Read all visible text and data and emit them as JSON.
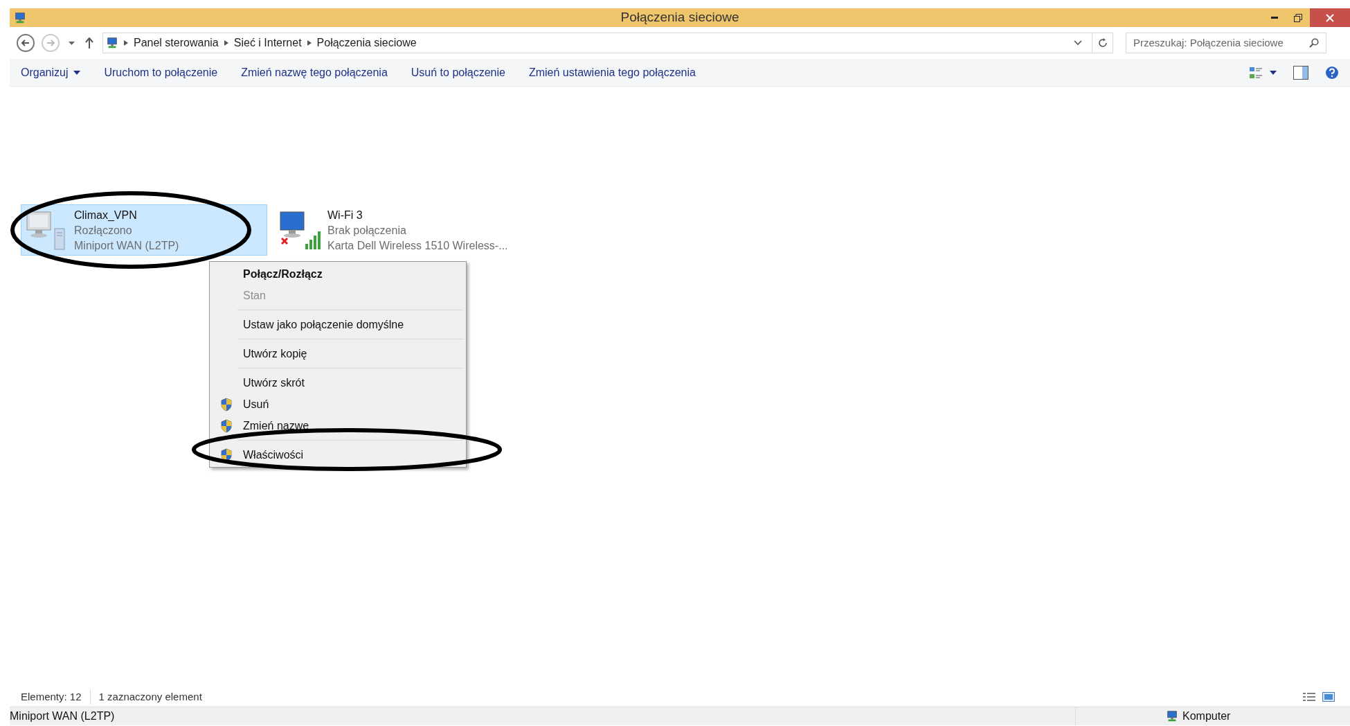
{
  "window": {
    "title": "Połączenia sieciowe"
  },
  "breadcrumb": [
    "Panel sterowania",
    "Sieć i Internet",
    "Połączenia sieciowe"
  ],
  "search": {
    "placeholder": "Przeszukaj: Połączenia sieciowe"
  },
  "toolbar": [
    {
      "label": "Organizuj",
      "dropdown": true
    },
    {
      "label": "Uruchom to połączenie",
      "dropdown": false
    },
    {
      "label": "Zmień nazwę tego połączenia",
      "dropdown": false
    },
    {
      "label": "Usuń to połączenie",
      "dropdown": false
    },
    {
      "label": "Zmień ustawienia tego połączenia",
      "dropdown": false
    }
  ],
  "connections": [
    {
      "kind": "vpn",
      "name": "Climax_VPN",
      "status": "Rozłączono",
      "device": "Miniport WAN (L2TP)",
      "selected": true
    },
    {
      "kind": "wifi",
      "name": "Wi-Fi 3",
      "status": "Brak połączenia",
      "device": "Karta Dell Wireless 1510 Wireless-...",
      "selected": false
    }
  ],
  "context_menu": [
    {
      "label": "Połącz/Rozłącz",
      "default": true,
      "disabled": false,
      "shield": false,
      "separator_before": false
    },
    {
      "label": "Stan",
      "default": false,
      "disabled": true,
      "shield": false,
      "separator_before": false
    },
    {
      "label": "Ustaw jako połączenie domyślne",
      "default": false,
      "disabled": false,
      "shield": false,
      "separator_before": true
    },
    {
      "label": "Utwórz kopię",
      "default": false,
      "disabled": false,
      "shield": false,
      "separator_before": true
    },
    {
      "label": "Utwórz skrót",
      "default": false,
      "disabled": false,
      "shield": false,
      "separator_before": true
    },
    {
      "label": "Usuń",
      "default": false,
      "disabled": false,
      "shield": true,
      "separator_before": false
    },
    {
      "label": "Zmień nazwę",
      "default": false,
      "disabled": false,
      "shield": true,
      "separator_before": false
    },
    {
      "label": "Właściwości",
      "default": false,
      "disabled": false,
      "shield": true,
      "separator_before": true
    }
  ],
  "status_bar": {
    "count": "Elementy: 12",
    "selection": "1 zaznaczony element"
  },
  "details_bar": {
    "description": "Miniport WAN (L2TP)",
    "location": "Komputer"
  }
}
